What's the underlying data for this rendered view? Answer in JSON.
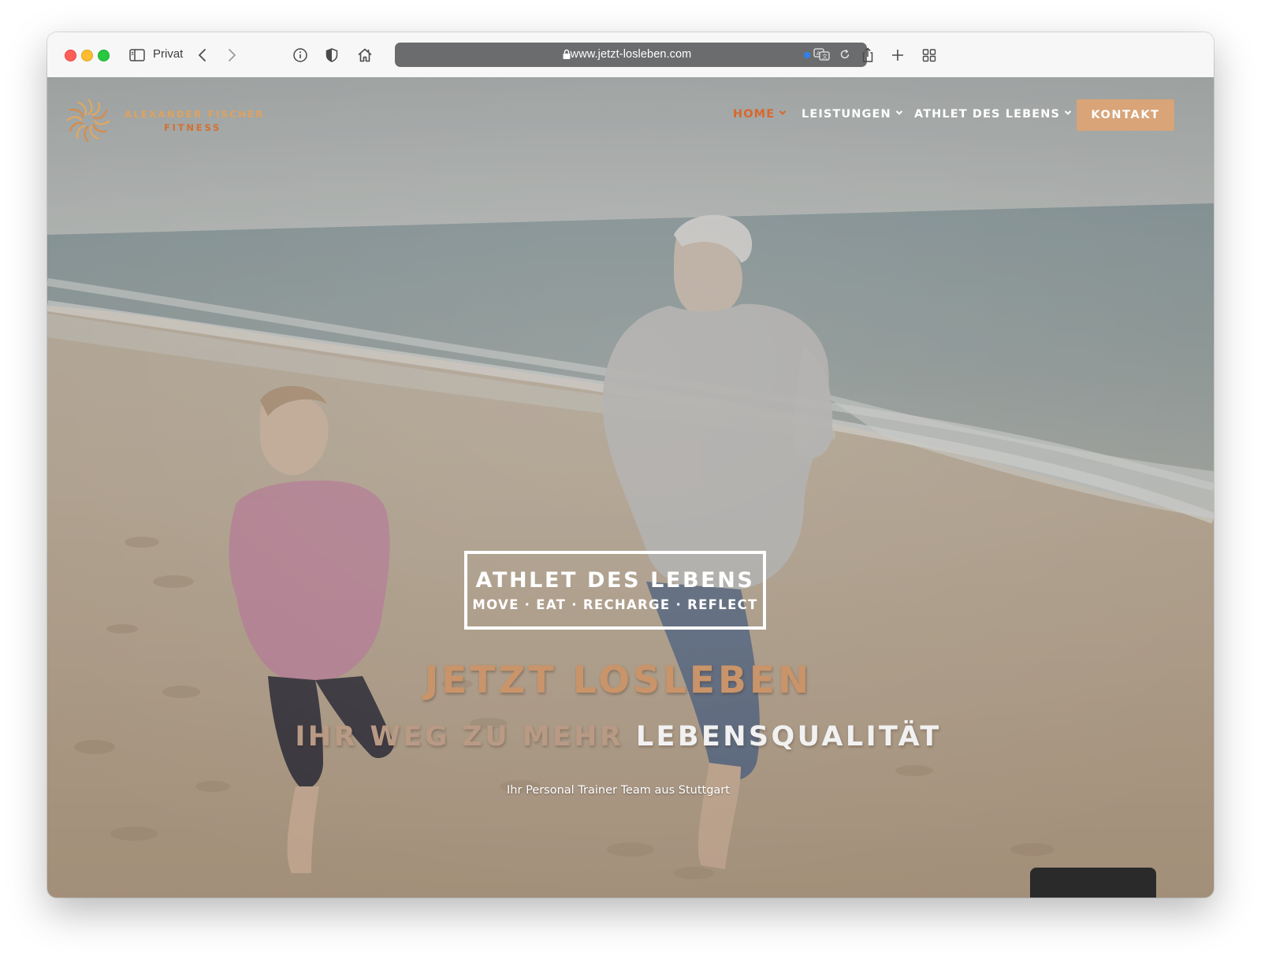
{
  "browser": {
    "profile_label": "Privat",
    "url": "www.jetzt-losleben.com"
  },
  "site": {
    "logo": {
      "line1": "ALEXANDER FISCHER",
      "line2": "FITNESS"
    },
    "nav": [
      {
        "label": "HOME",
        "active": true
      },
      {
        "label": "LEISTUNGEN",
        "active": false
      },
      {
        "label": "ATHLET DES LEBENS",
        "active": false
      }
    ],
    "cta_label": "KONTAKT"
  },
  "hero": {
    "badge_title": "ATHLET DES LEBENS",
    "badge_subtitle": "MOVE · EAT · RECHARGE · REFLECT",
    "headline": "JETZT LOSLEBEN",
    "subheadline_part1": "IHR WEG ZU MEHR",
    "subheadline_part2": "LEBENSQUALITÄT",
    "tagline": "Ihr Personal Trainer Team aus Stuttgart"
  },
  "colors": {
    "accent_orange": "#d8682e",
    "logo_gold": "#e0a25b",
    "cta_background": "#d8a478",
    "headline_tan": "#c9946a"
  }
}
